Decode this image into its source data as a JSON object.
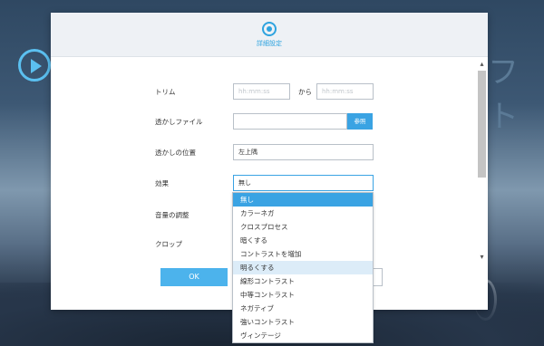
{
  "background": {
    "app_title_fragment": "フト"
  },
  "dialog": {
    "header_title": "詳細設定",
    "rows": {
      "trim_label": "トリム",
      "trim_start_placeholder": "hh:mm:ss",
      "trim_from": "から",
      "trim_end_placeholder": "hh:mm:ss",
      "watermark_file_label": "透かしファイル",
      "watermark_file_value": "",
      "browse_label": "参照",
      "watermark_position_label": "透かしの位置",
      "watermark_position_value": "左上隅",
      "effect_label": "効果",
      "effect_value": "無し",
      "volume_label": "音量の調整",
      "crop_label": "クロップ"
    },
    "ok_label": "OK"
  },
  "effect_dropdown": {
    "options": [
      "無し",
      "カラーネガ",
      "クロスプロセス",
      "暗くする",
      "コントラストを増加",
      "明るくする",
      "線形コントラスト",
      "中等コントラスト",
      "ネガティブ",
      "強いコントラスト",
      "ヴィンテージ"
    ],
    "selected_index": 0,
    "hover_index": 5
  }
}
